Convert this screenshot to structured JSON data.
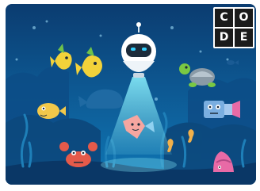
{
  "logo": {
    "letters": [
      "C",
      "O",
      "D",
      "E"
    ]
  },
  "scene": {
    "characters": [
      "robot-icon",
      "whale-icon",
      "turtle-icon",
      "crab-icon",
      "hermit-crab-icon",
      "boxfish-icon",
      "starfish-icon",
      "seahorse-icon",
      "fish-icon"
    ],
    "colors": {
      "water_top": "#0b3c70",
      "water_bottom": "#0f78b6",
      "light_beam": "#7fe3f4",
      "robot_body": "#ffffff",
      "robot_visor": "#1c2b3a",
      "robot_eyes": "#33d1ff"
    }
  }
}
